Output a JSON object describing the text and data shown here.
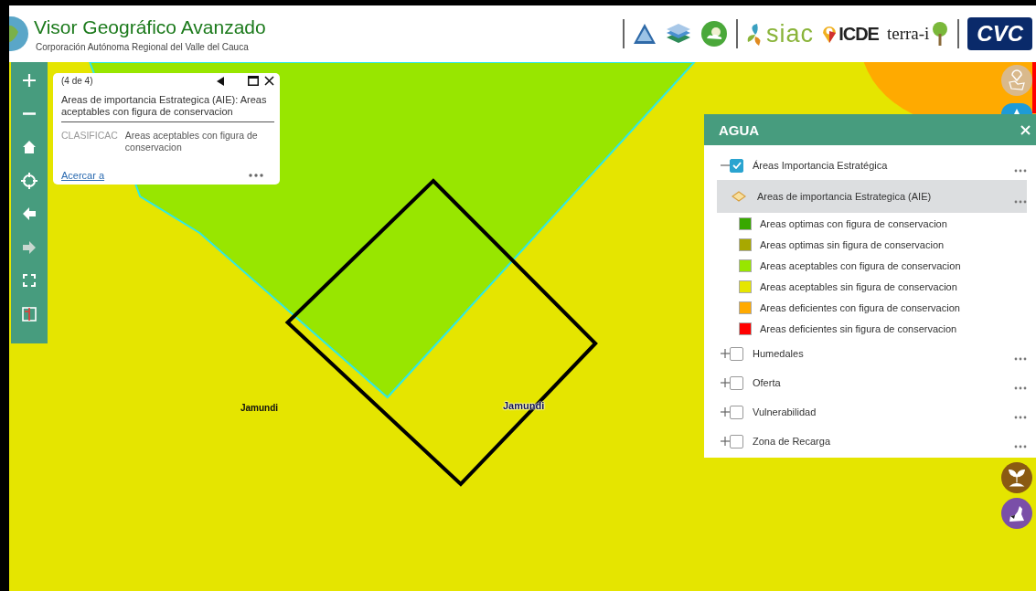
{
  "header": {
    "title": "Visor Geográfico Avanzado",
    "subtitle": "Corporación Autónoma Regional del Valle del Cauca",
    "logos": [
      {
        "kind": "mountain"
      },
      {
        "kind": "layers"
      },
      {
        "kind": "weather"
      },
      {
        "kind": "siac",
        "text": "siac"
      },
      {
        "kind": "icde",
        "text": "ICDE"
      },
      {
        "kind": "terra",
        "text": "terra-i"
      },
      {
        "kind": "cvc",
        "text": "CVC"
      }
    ]
  },
  "map": {
    "labels": [
      {
        "text": "Jamundi",
        "kind": "plain"
      },
      {
        "text": "Jamundi",
        "kind": "halo"
      }
    ]
  },
  "toolbar": [
    {
      "kind": "zoom-in"
    },
    {
      "kind": "zoom-out"
    },
    {
      "kind": "home"
    },
    {
      "kind": "locate"
    },
    {
      "kind": "back"
    },
    {
      "kind": "forward",
      "disabled": true
    },
    {
      "kind": "fullscreen"
    },
    {
      "kind": "swipe"
    }
  ],
  "popup": {
    "counter": "(4 de 4)",
    "title": "Areas de importancia Estrategica (AIE): Areas aceptables con figura de conservacion",
    "fields": [
      {
        "name": "CLASIFICAC",
        "value": "Areas aceptables con figura de conservacion"
      }
    ],
    "link": "Acercar a"
  },
  "layer_panel": {
    "title": "AGUA",
    "layers": [
      {
        "label": "Áreas Importancia Estratégica",
        "checked": true,
        "expanded": true,
        "children": [
          {
            "label": "Areas de importancia Estrategica (AIE)",
            "selected": true,
            "legend": [
              {
                "label": "Areas optimas con figura de conservacion",
                "color": "#38a800"
              },
              {
                "label": "Areas optimas sin figura de conservacion",
                "color": "#a8a800"
              },
              {
                "label": "Areas aceptables con figura de conservacion",
                "color": "#98e600"
              },
              {
                "label": "Areas aceptables sin figura de conservacion",
                "color": "#e6e600"
              },
              {
                "label": "Areas deficientes con figura de conservacion",
                "color": "#ffaa00"
              },
              {
                "label": "Areas deficientes sin figura de conservacion",
                "color": "#ff0000"
              }
            ]
          }
        ]
      },
      {
        "label": "Humedales",
        "checked": false,
        "expanded": false
      },
      {
        "label": "Oferta",
        "checked": false,
        "expanded": false
      },
      {
        "label": "Vulnerabilidad",
        "checked": false,
        "expanded": false
      },
      {
        "label": "Zona de Recarga",
        "checked": false,
        "expanded": false
      }
    ]
  },
  "side_buttons": [
    {
      "kind": "pin-map",
      "color": "#d9b98c"
    },
    {
      "kind": "info",
      "color": "#1e9bd7"
    },
    {
      "kind": "plant",
      "color": "#8a5a12"
    },
    {
      "kind": "region",
      "color": "#7a4fa8"
    }
  ]
}
